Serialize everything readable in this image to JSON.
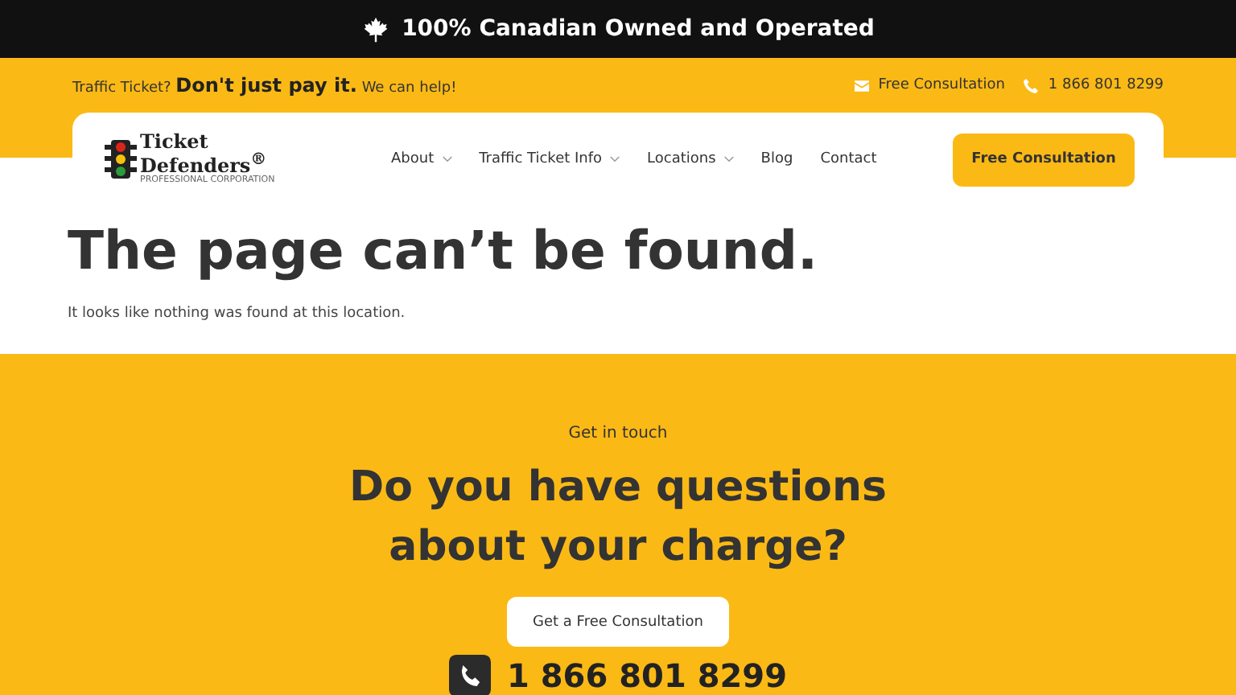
{
  "announcement": {
    "text": "100% Canadian Owned and Operated"
  },
  "topbar": {
    "tagline": {
      "lead": "Traffic Ticket?",
      "strong": "Don't just pay it.",
      "tail": "We can help!"
    },
    "contacts": [
      {
        "kind": "mail",
        "label": "Free Consultation"
      },
      {
        "kind": "phone",
        "label": "1 866 801 8299"
      }
    ]
  },
  "logo": {
    "line_1": "Ticket",
    "line_2": "Defenders$^{®}$",
    "subtitle": "PROFESSIONAL CORPORATION"
  },
  "nav": [
    {
      "label": "About",
      "has_dropdown": true
    },
    {
      "label": "Traffic Ticket Info",
      "has_dropdown": true
    },
    {
      "label": "Locations",
      "has_dropdown": true
    },
    {
      "label": "Blog",
      "has_dropdown": false
    },
    {
      "label": "Contact",
      "has_dropdown": false
    }
  ],
  "nav_button": "Free Consultation",
  "error": {
    "title": "The page can’t be found.",
    "message": "It looks like nothing was found at this location."
  },
  "cta": {
    "eyebrow": "Get in touch",
    "headline_lines": [
      "Do you have questions",
      "about your charge?"
    ],
    "button": "Get a Free Consultation",
    "phone": "1 866 801 8299"
  }
}
